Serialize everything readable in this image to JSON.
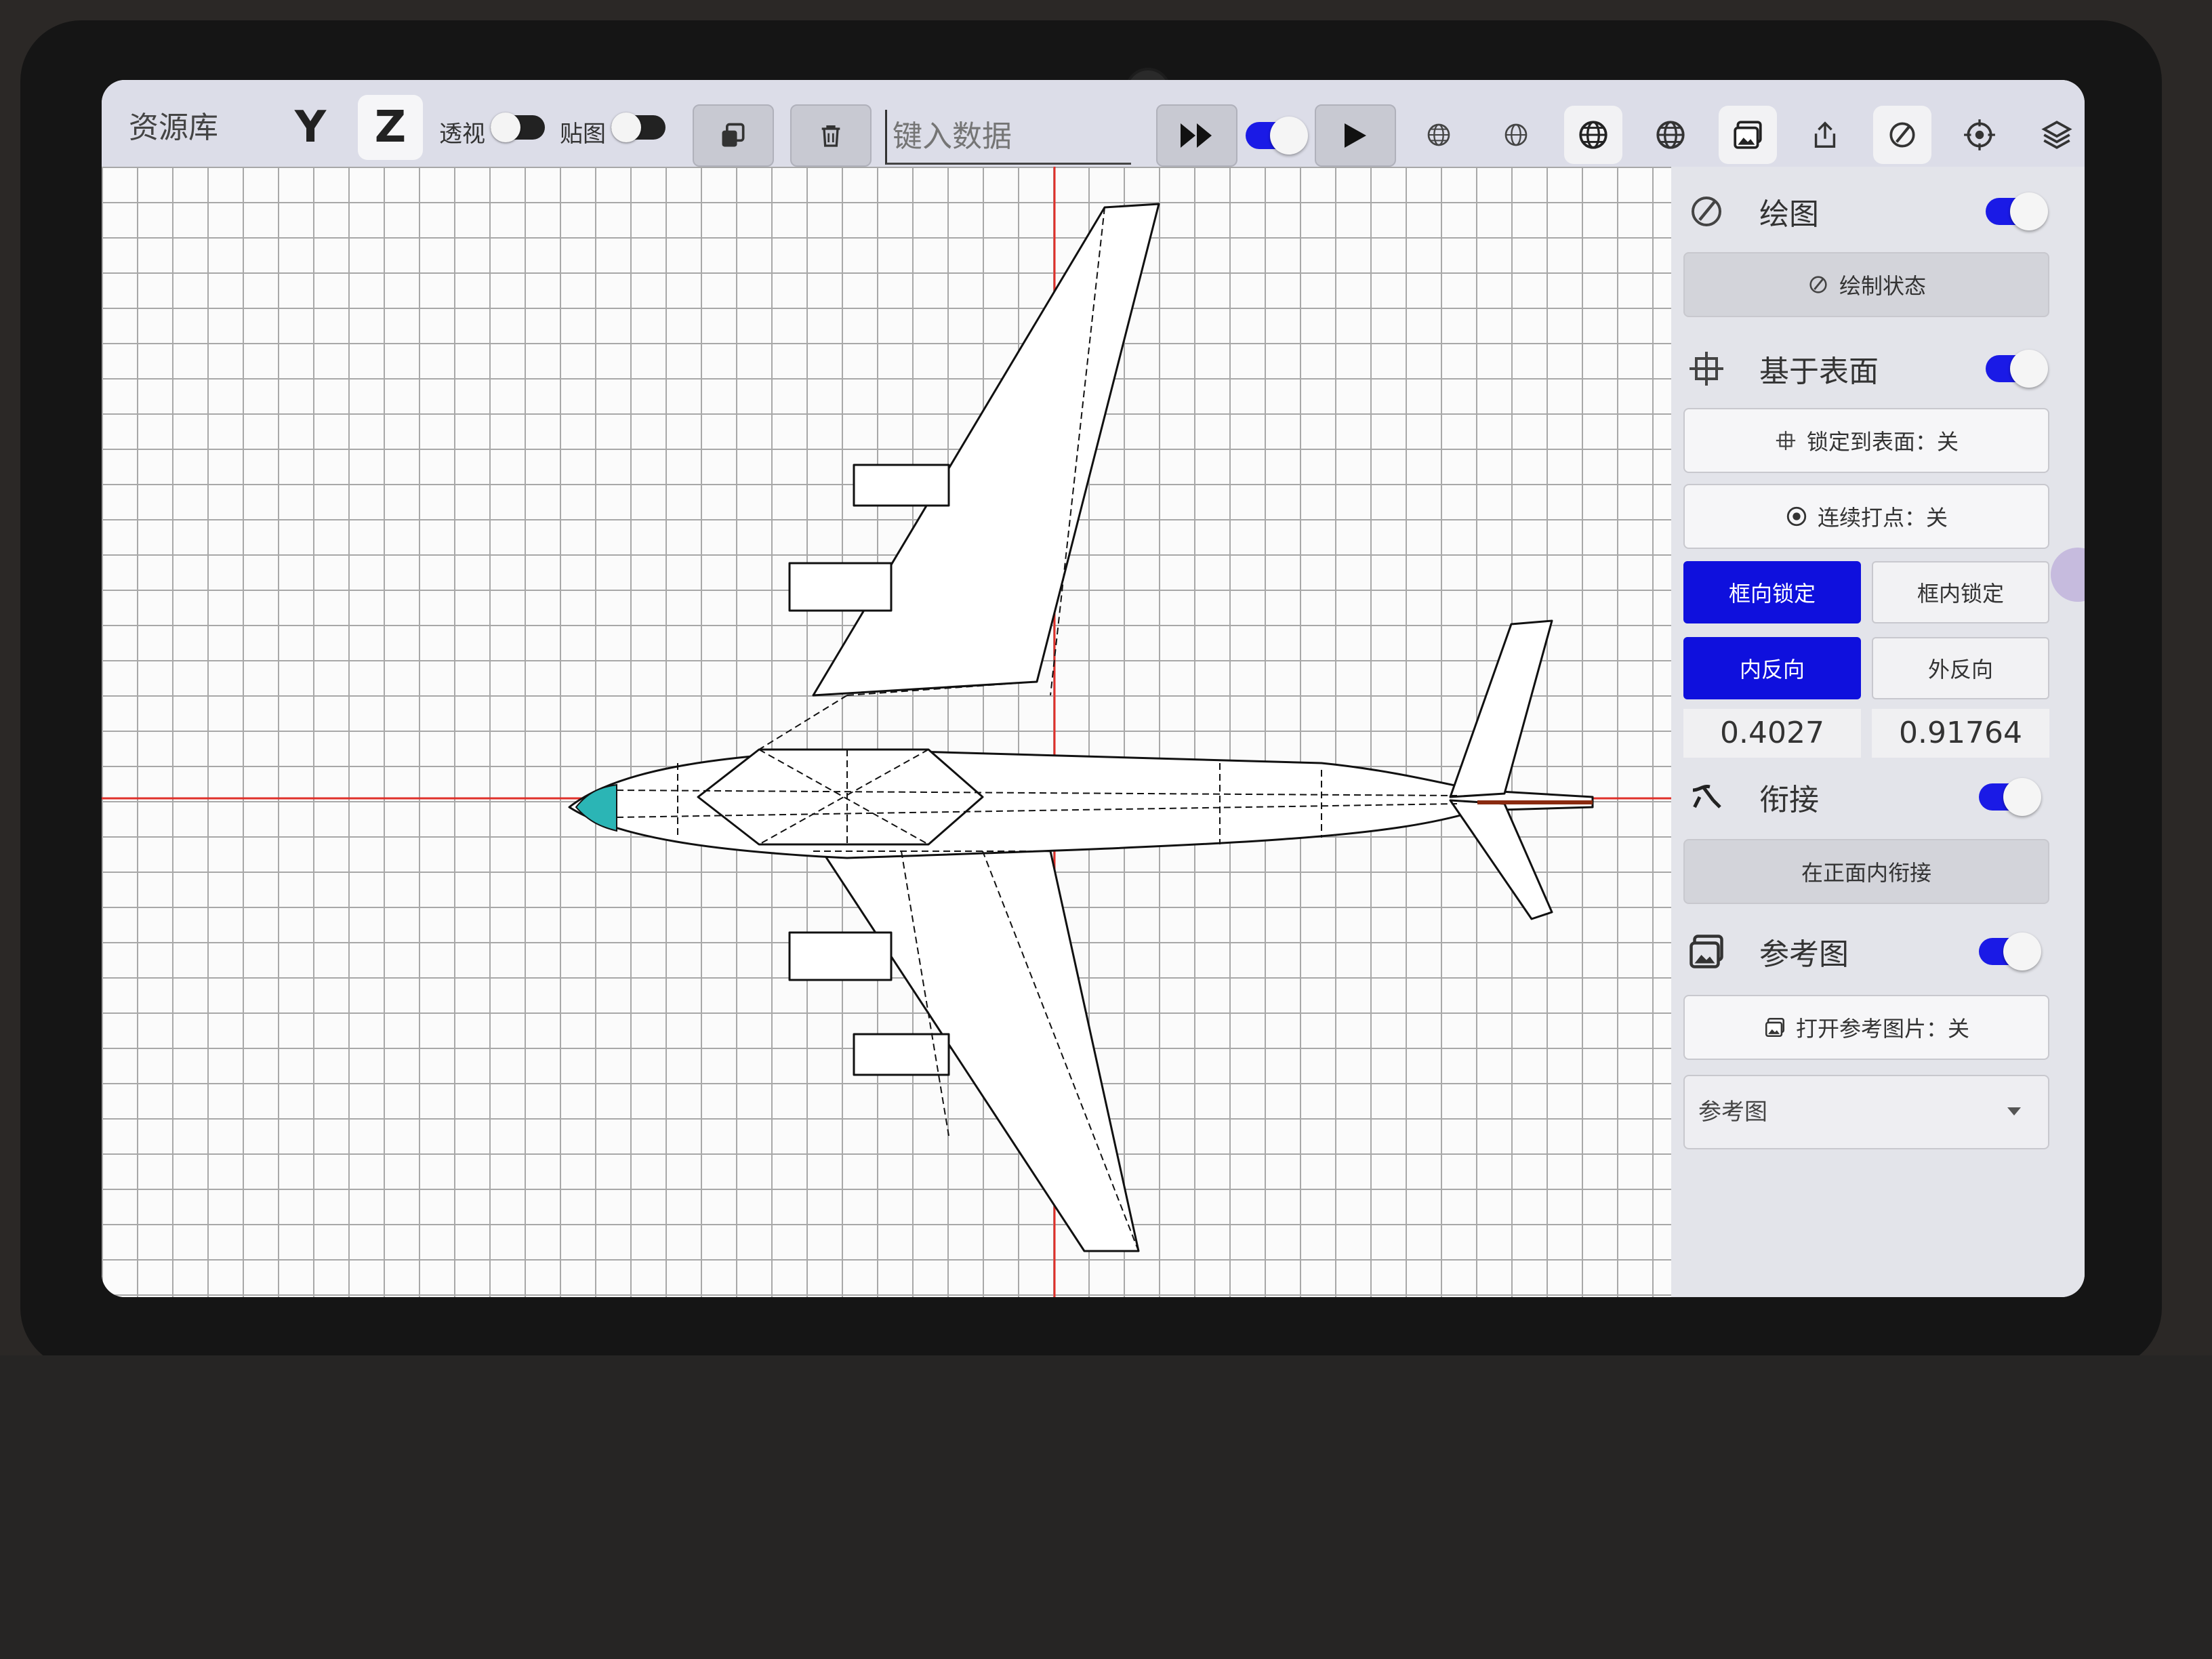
{
  "toolbar": {
    "library_label": "资源库",
    "axis_y": "Y",
    "axis_z": "Z",
    "perspective_label": "透视",
    "texture_label": "贴图",
    "input_placeholder": "键入数据"
  },
  "side_panel": {
    "draw": {
      "title": "绘图",
      "button": "绘制状态",
      "toggle_on": true
    },
    "surface": {
      "title": "基于表面",
      "lock_button": "锁定到表面：关",
      "continuous_button": "连续打点：关",
      "toggle_on": true
    },
    "lock_modes": {
      "frame_direction": "框向锁定",
      "in_frame": "框内锁定",
      "selected": "框向锁定"
    },
    "direction_modes": {
      "inner": "内反向",
      "outer": "外反向",
      "selected": "内反向"
    },
    "values": {
      "left": "0.4027",
      "right": "0.91764"
    },
    "connect": {
      "title": "衔接",
      "button": "在正面内衔接",
      "toggle_on": true
    },
    "reference": {
      "title": "参考图",
      "open_button": "打开参考图片：关",
      "dropdown_value": "参考图",
      "toggle_on": true
    }
  },
  "colors": {
    "accent_blue": "#0f10dd",
    "axis_red": "#e0302a",
    "grid_line": "#a8a8a8"
  }
}
